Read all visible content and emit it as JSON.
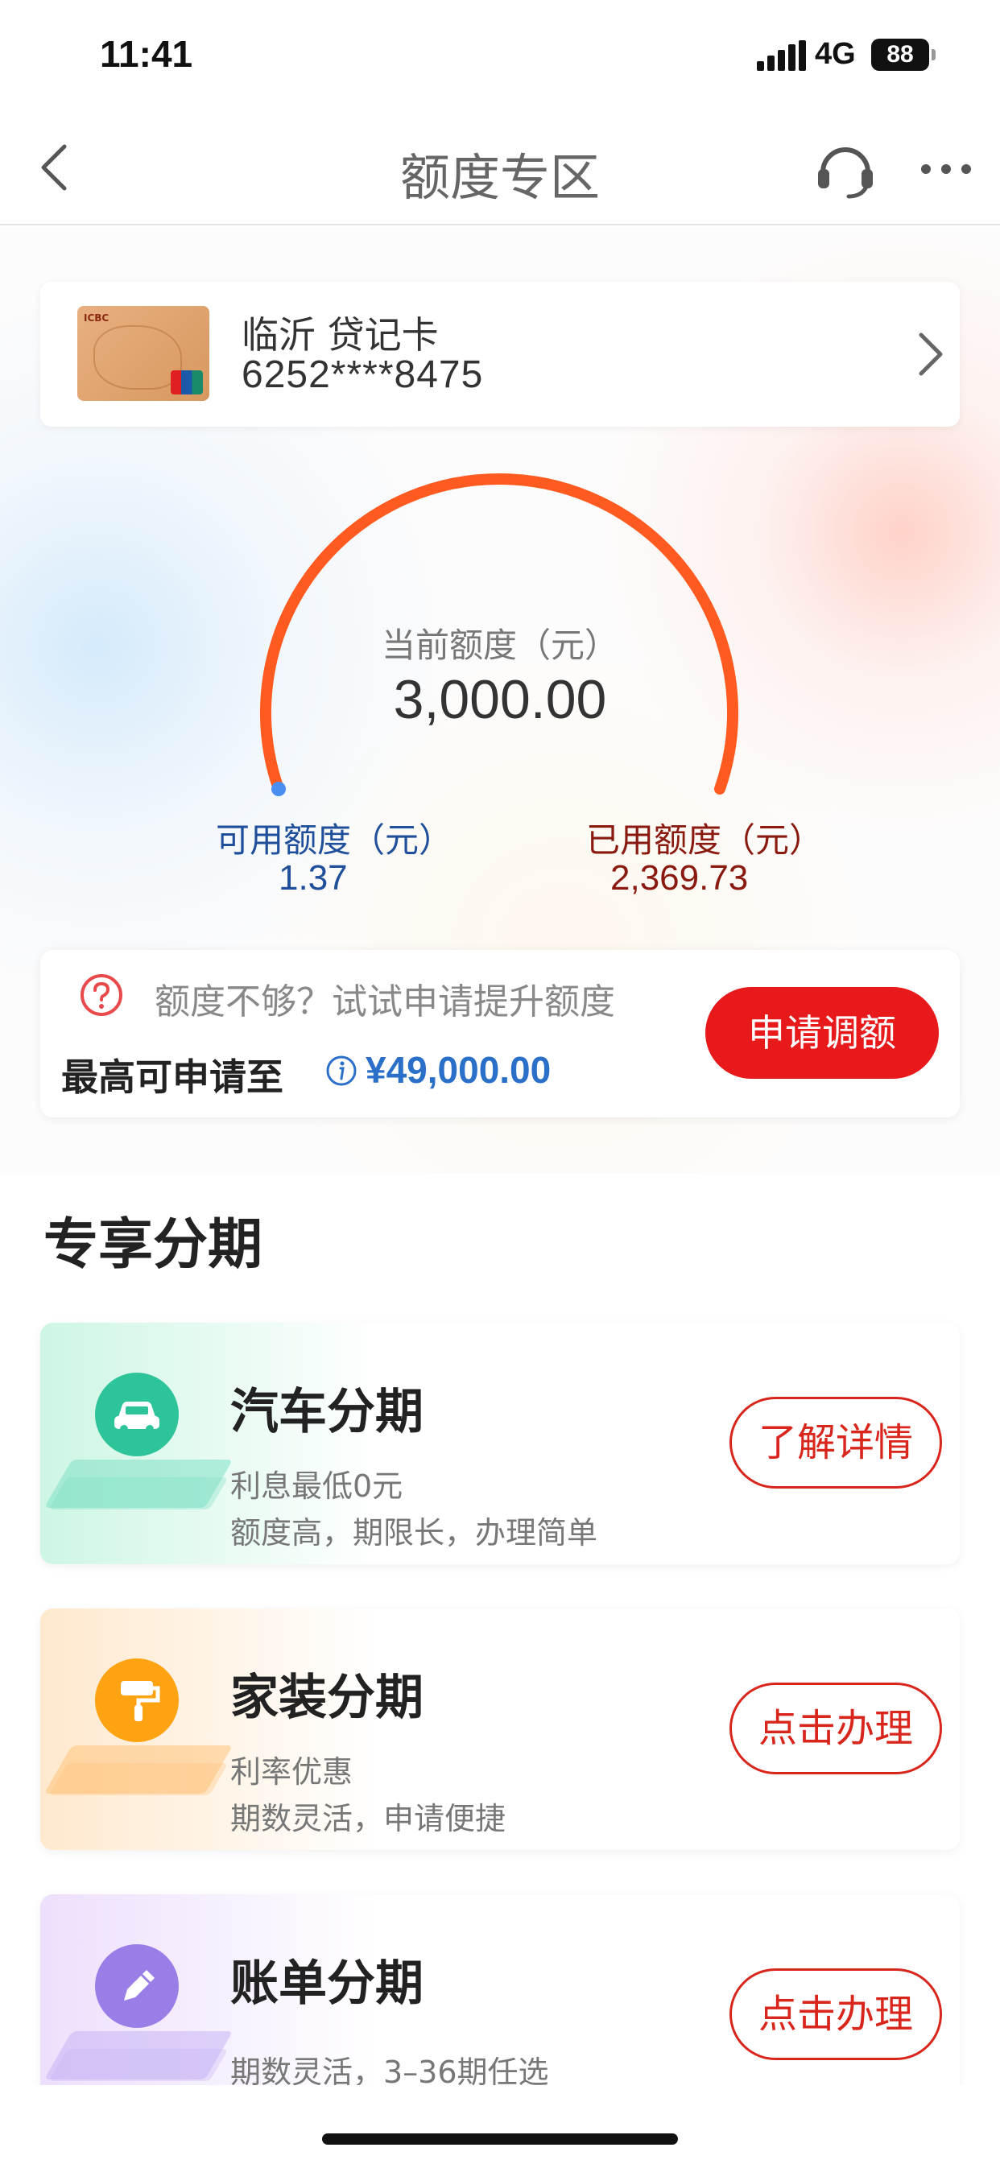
{
  "status_bar": {
    "time": "11:41",
    "network": "4G",
    "battery": "88"
  },
  "nav": {
    "title": "额度专区",
    "back_icon": "chevron-left-icon",
    "service_icon": "headset-icon",
    "more_icon": "more-dots-icon"
  },
  "card": {
    "name": "临沂 贷记卡",
    "number": "6252****8475"
  },
  "gauge": {
    "total_label": "当前额度（元）",
    "total_value": "3,000.00",
    "available_label": "可用额度（元）",
    "available_value": "1.37",
    "used_label": "已用额度（元）",
    "used_value": "2,369.73",
    "colors": {
      "arc": "#ff5a1f",
      "available": "#1f4f9a",
      "used": "#8a1a10"
    }
  },
  "raise": {
    "prompt": "额度不够？试试申请提升额度",
    "max_label": "最高可申请至",
    "max_amount": "¥49,000.00",
    "button": "申请调额"
  },
  "section": {
    "title": "专享分期"
  },
  "installments": [
    {
      "title": "汽车分期",
      "desc1": "利息最低0元",
      "desc2": "额度高，期限长，办理简单",
      "button": "了解详情",
      "icon": "car-icon",
      "color": "#2ec49a"
    },
    {
      "title": "家装分期",
      "desc1": "利率优惠",
      "desc2": "期数灵活，申请便捷",
      "button": "点击办理",
      "icon": "paint-roller-icon",
      "color": "#ffa312"
    },
    {
      "title": "账单分期",
      "desc1": "期数灵活，3–36期任选",
      "desc2": "",
      "button": "点击办理",
      "icon": "pencil-icon",
      "color": "#9a7ee8"
    }
  ]
}
